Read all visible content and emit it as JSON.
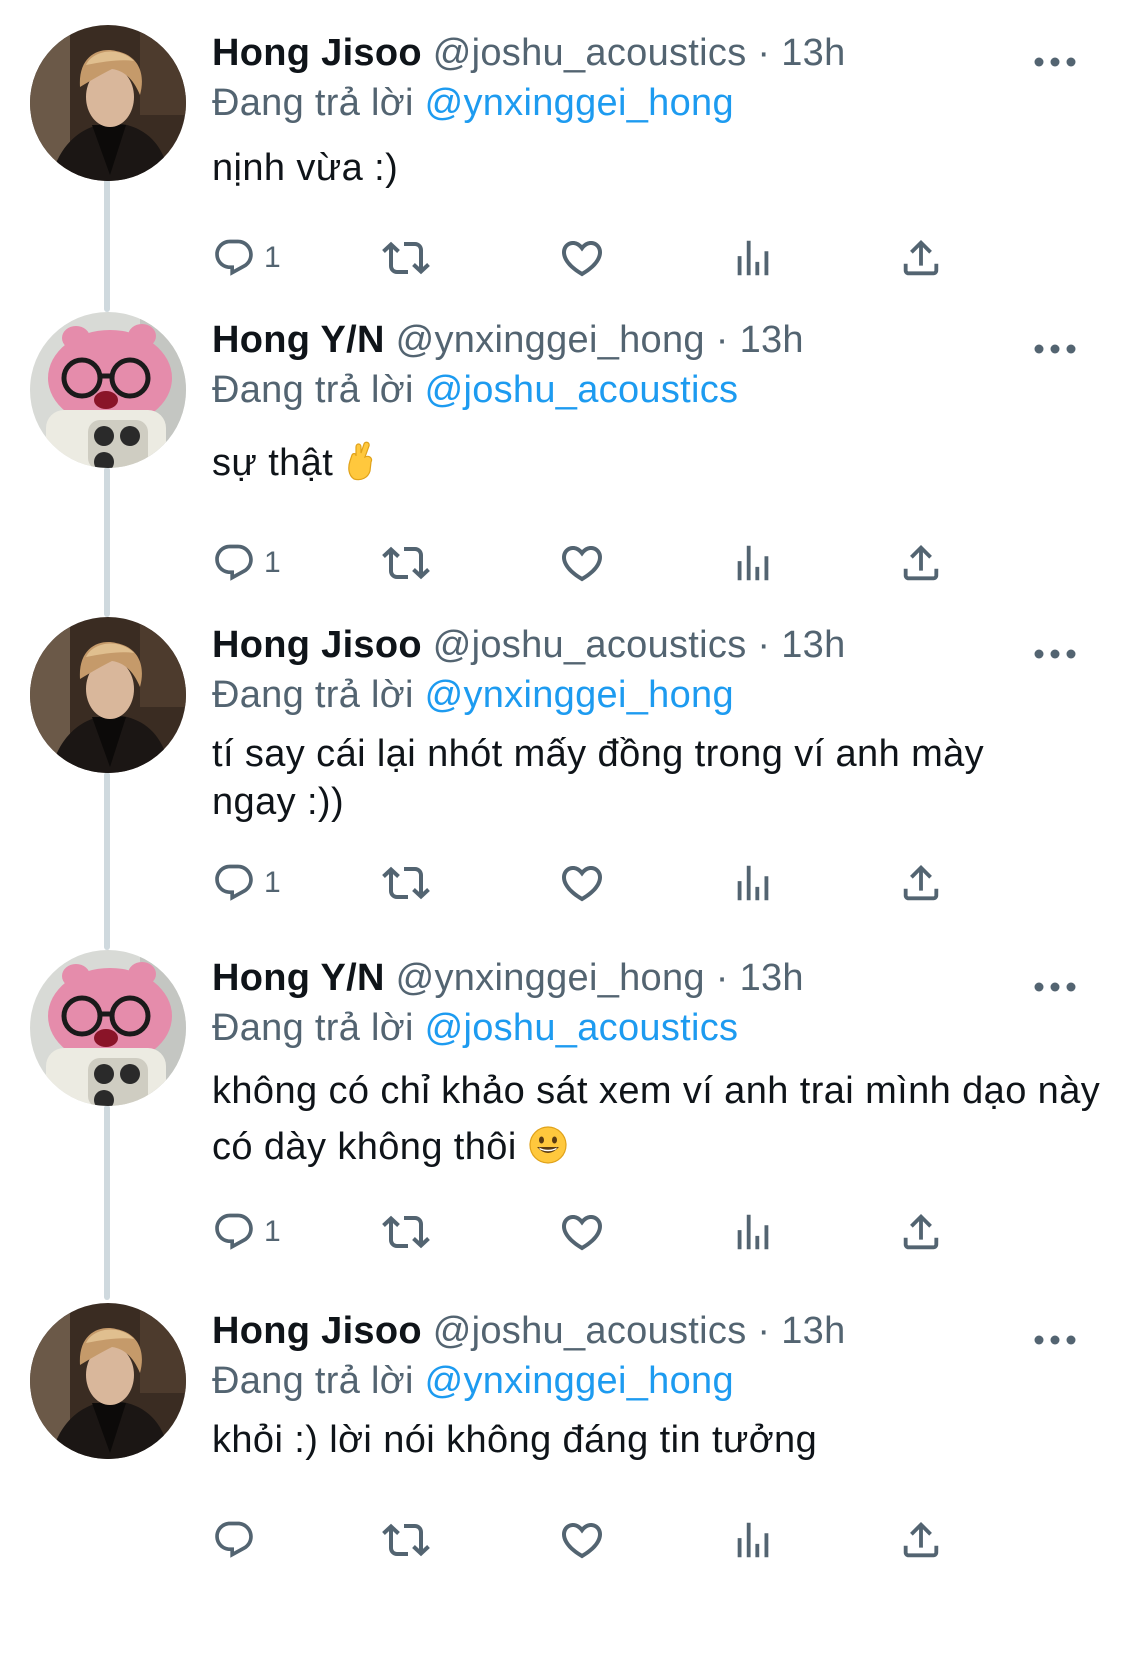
{
  "colors": {
    "text": "#0f1419",
    "secondary": "#536471",
    "link": "#1d9bf0",
    "thread_line": "#cfd9de"
  },
  "reply_prefix": "Đang trả lời",
  "tweets": [
    {
      "name": "Hong Jisoo",
      "handle": "@joshu_acoustics",
      "separator": "·",
      "time": "13h",
      "reply_to": "@ynxinggei_hong",
      "text": "nịnh vừa :)",
      "reply_count": "1",
      "avatar": "joshua-avatar"
    },
    {
      "name": "Hong Y/N",
      "handle": "@ynxinggei_hong",
      "separator": "·",
      "time": "13h",
      "reply_to": "@joshu_acoustics",
      "text": "sự thật",
      "emoji": "crossed-fingers-emoji",
      "reply_count": "1",
      "avatar": "pink-plush-avatar"
    },
    {
      "name": "Hong Jisoo",
      "handle": "@joshu_acoustics",
      "separator": "·",
      "time": "13h",
      "reply_to": "@ynxinggei_hong",
      "text": "tí say cái lại nhót mấy đồng trong ví anh mày ngay :))",
      "reply_count": "1",
      "avatar": "joshua-avatar"
    },
    {
      "name": "Hong Y/N",
      "handle": "@ynxinggei_hong",
      "separator": "·",
      "time": "13h",
      "reply_to": "@joshu_acoustics",
      "text": "không có chỉ khảo sát xem ví anh trai mình dạo này có dày không thôi",
      "emoji": "grinning-face-emoji",
      "reply_count": "1",
      "avatar": "pink-plush-avatar"
    },
    {
      "name": "Hong Jisoo",
      "handle": "@joshu_acoustics",
      "separator": "·",
      "time": "13h",
      "reply_to": "@ynxinggei_hong",
      "text": "khỏi :) lời nói không đáng tin tưởng",
      "reply_count": "",
      "avatar": "joshua-avatar"
    }
  ]
}
